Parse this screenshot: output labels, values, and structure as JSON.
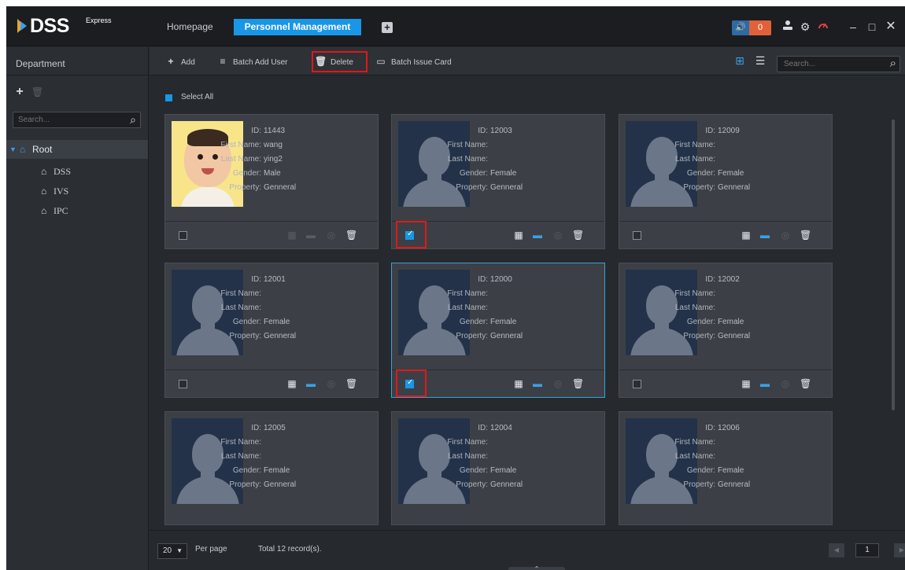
{
  "app": {
    "brand": "DSS",
    "brand_sub": "Express"
  },
  "nav": {
    "tabs": [
      {
        "label": "Homepage"
      },
      {
        "label": "Personnel Management"
      }
    ],
    "notification_count": "0"
  },
  "department": {
    "title": "Department",
    "search_placeholder": "Search...",
    "tree": {
      "root": "Root",
      "children": [
        "DSS",
        "IVS",
        "IPC"
      ]
    }
  },
  "toolbar": {
    "add": "Add",
    "batch_add_user": "Batch Add User",
    "delete": "Delete",
    "batch_issue_card": "Batch Issue Card",
    "search_placeholder": "Search..."
  },
  "select_all": "Select All",
  "labels": {
    "id": "ID:",
    "first_name": "First Name:",
    "last_name": "Last Name:",
    "gender": "Gender:",
    "property": "Property:"
  },
  "cards": [
    {
      "id": "11443",
      "first_name": "wang",
      "last_name": "ying2",
      "gender": "Male",
      "property": "Genneral",
      "checked": false,
      "photo": "baby"
    },
    {
      "id": "12003",
      "first_name": "",
      "last_name": "",
      "gender": "Female",
      "property": "Genneral",
      "checked": true,
      "photo": "silhouette"
    },
    {
      "id": "12009",
      "first_name": "",
      "last_name": "",
      "gender": "Female",
      "property": "Genneral",
      "checked": false,
      "photo": "silhouette"
    },
    {
      "id": "12001",
      "first_name": "",
      "last_name": "",
      "gender": "Female",
      "property": "Genneral",
      "checked": false,
      "photo": "silhouette"
    },
    {
      "id": "12000",
      "first_name": "",
      "last_name": "",
      "gender": "Female",
      "property": "Genneral",
      "checked": true,
      "photo": "silhouette"
    },
    {
      "id": "12002",
      "first_name": "",
      "last_name": "",
      "gender": "Female",
      "property": "Genneral",
      "checked": false,
      "photo": "silhouette"
    },
    {
      "id": "12005",
      "first_name": "",
      "last_name": "",
      "gender": "Female",
      "property": "Genneral",
      "checked": false,
      "photo": "silhouette"
    },
    {
      "id": "12004",
      "first_name": "",
      "last_name": "",
      "gender": "Female",
      "property": "Genneral",
      "checked": false,
      "photo": "silhouette"
    },
    {
      "id": "12006",
      "first_name": "",
      "last_name": "",
      "gender": "Female",
      "property": "Genneral",
      "checked": false,
      "photo": "silhouette"
    }
  ],
  "footer": {
    "per_page_value": "20",
    "per_page_label": "Per page",
    "total": "Total 12 record(s).",
    "page": "1"
  },
  "colors": {
    "accent": "#1996e6",
    "highlight": "#e01818",
    "background": "#26292e"
  }
}
